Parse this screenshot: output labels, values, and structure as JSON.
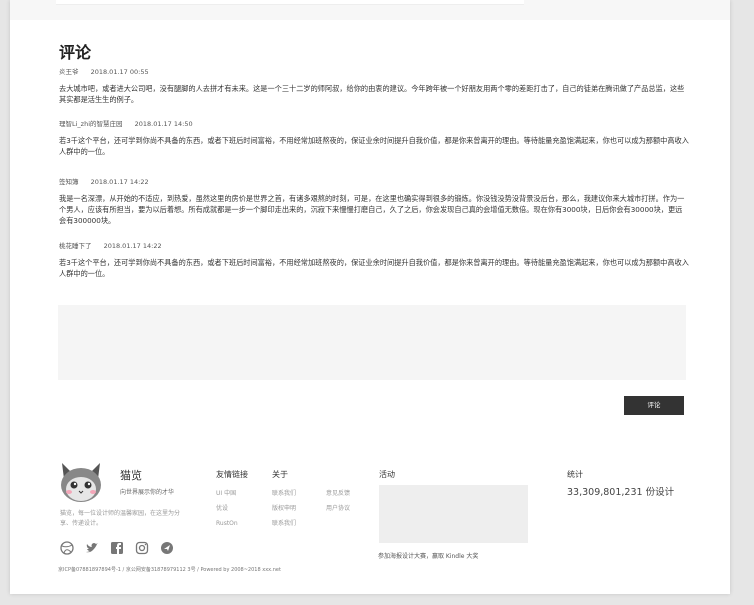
{
  "section_title": "评论",
  "comments": [
    {
      "author": "炎王爷",
      "date": "2018.01.17 00:55",
      "text": "去大城市吧，或者进大公司吧，没有腿脚的人去拼才有未来。这是一个三十二岁的师阿叔，给你的由衷的建议。今年跨年被一个好朋友用两个零的差距打击了，自己的徒弟在腾讯做了产品总监，这些其实都是活生生的例子。"
    },
    {
      "author": "理智Li_zhi的智慧庄园",
      "date": "2018.01.17 14:50",
      "text": "若3千这个平台，还可学到你尚不具备的东西，或者下班后时间富裕，不用经常加班熬夜的，保证业余时间提升自我价值，都是你来曾离开的理由。等待能量充盈饱满起来，你也可以成为那额中高收入人群中的一位。"
    },
    {
      "author": "签知簿",
      "date": "2018.01.17 14:22",
      "text": "我是一名深漂，从开始的不适应，到热爱，虽然这里的房价是世界之首，有诸多艰熬的时刻，可是，在这里也确实得到很多的锻炼。你没钱没势没背景没后台，那么，我建议你来大城市打拼。作为一个男人，应该有所担当，要为以后着想。所有成就都是一步一个脚印走出来的，沉寂下来慢慢打磨自己，久了之后，你会发现自己真的会增值无数倍。现在你有3000块，日后你会有30000块，更远会有300000块。"
    },
    {
      "author": "桃花睡下了",
      "date": "2018.01.17 14:22",
      "text": "若3千这个平台，还可学到你尚不具备的东西，或者下班后时间富裕，不用经常加班熬夜的，保证业余时间提升自我价值，都是你来曾离开的理由。等待能量充盈饱满起来，你也可以成为那额中高收入人群中的一位。"
    }
  ],
  "submit_label": "评论",
  "footer": {
    "brand_name": "猫览",
    "slogan": "向世界展示你的才华",
    "description": "猫览，每一位设计师的温馨家园，在这里为分享、传递设计。",
    "social_icons": [
      "dribbble-icon",
      "twitter-icon",
      "facebook-icon",
      "instagram-icon",
      "share-icon"
    ],
    "friend_links_title": "友情链接",
    "friend_links": [
      "UI 中国",
      "优设",
      "RustOn"
    ],
    "about_title": "关于",
    "about_links_1": [
      "联系我们",
      "版权申明",
      "联系我们"
    ],
    "about_links_2": [
      "意见反馈",
      "用户协议"
    ],
    "activity_title": "活动",
    "activity_caption": "参加海报设计大赛，赢取 Kindle 大奖",
    "stats_title": "统计",
    "stats_value": "33,309,801,231 份设计",
    "copyright": "京ICP备07881897894号-1 / 京公网安备31878979112 3号 / Powered by 2008~2018 xxx.net"
  },
  "colors": {
    "accent": "#333333",
    "background": "#e6e6e6"
  }
}
